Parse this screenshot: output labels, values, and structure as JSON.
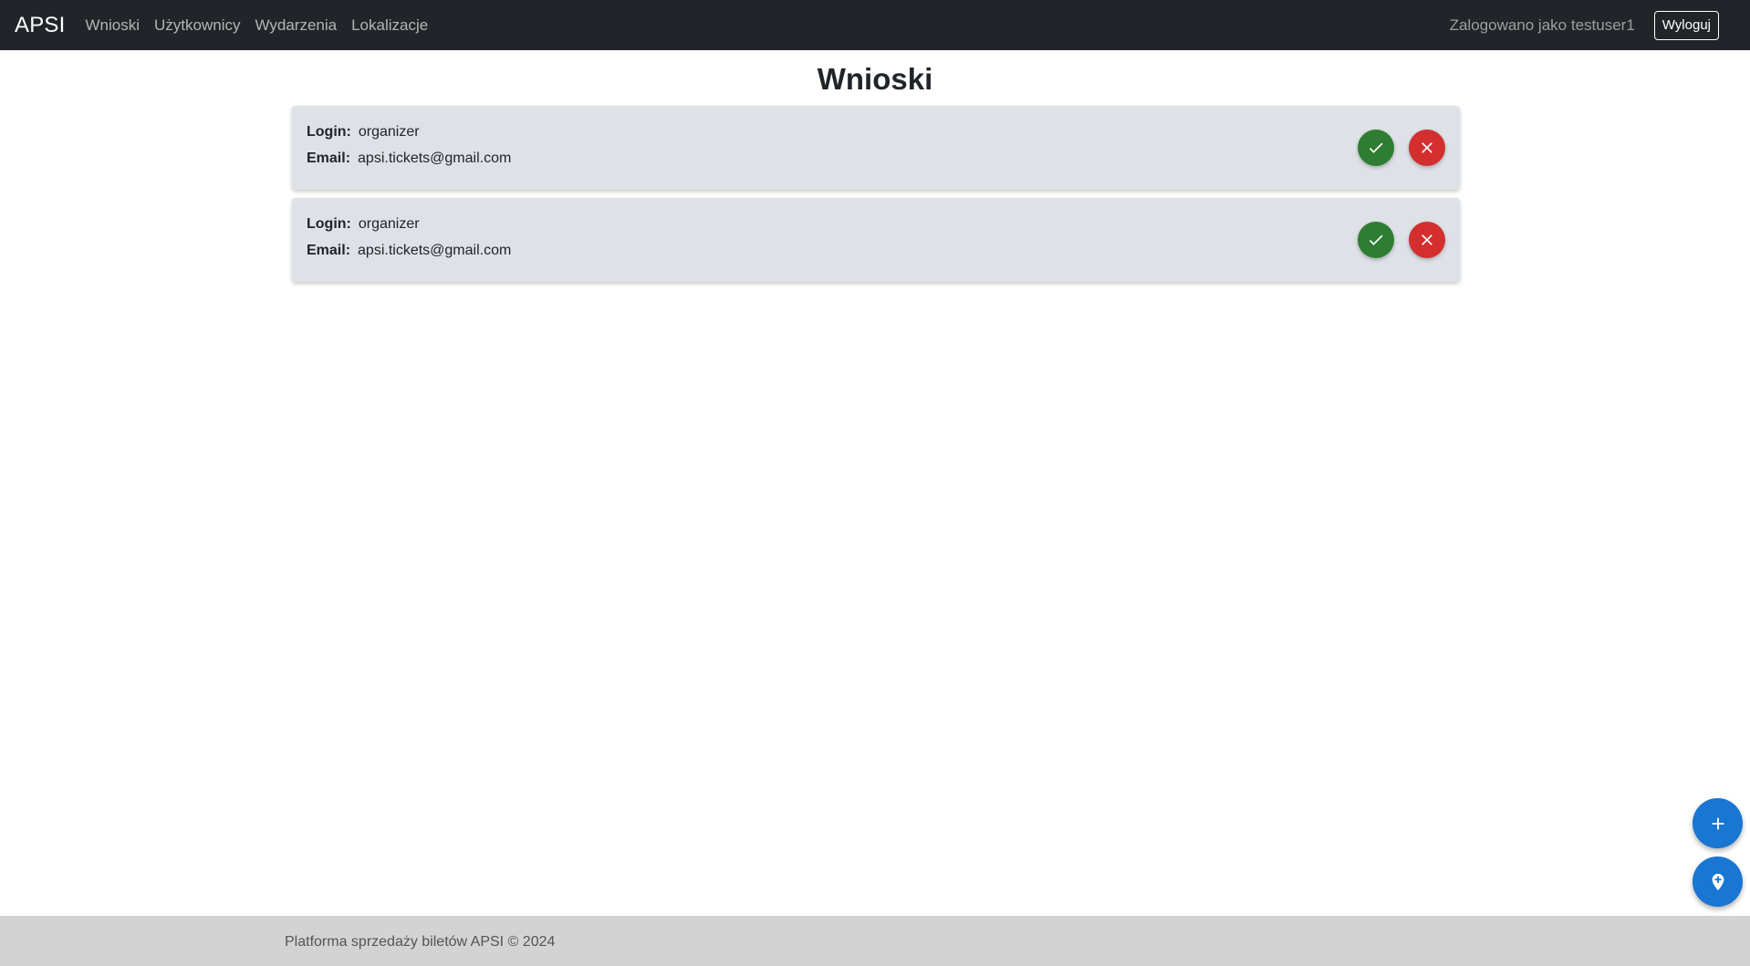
{
  "nav": {
    "brand": "APSI",
    "links": [
      "Wnioski",
      "Użytkownicy",
      "Wydarzenia",
      "Lokalizacje"
    ],
    "logged_in": "Zalogowano jako testuser1",
    "logout_label": "Wyloguj"
  },
  "page": {
    "title": "Wnioski"
  },
  "labels": {
    "login": "Login:",
    "email": "Email:"
  },
  "requests": [
    {
      "login": "organizer",
      "email": "apsi.tickets@gmail.com"
    },
    {
      "login": "organizer",
      "email": "apsi.tickets@gmail.com"
    }
  ],
  "icons": {
    "accept": "check-icon",
    "reject": "close-icon",
    "fab_add": "plus-icon",
    "fab_location": "add-location-icon"
  },
  "colors": {
    "navbar": "#212529",
    "card": "#dee2e6",
    "accept": "#2e7d32",
    "reject": "#d32f2f",
    "fab": "#1976d2",
    "footer": "#d3d3d3"
  },
  "footer": {
    "text": "Platforma sprzedaży biletów APSI © 2024"
  }
}
